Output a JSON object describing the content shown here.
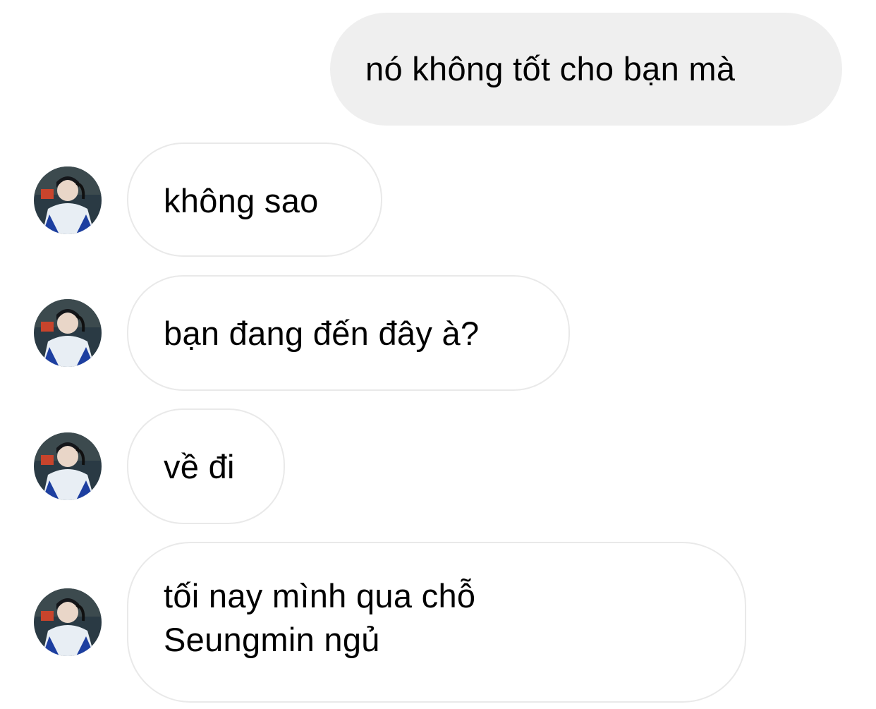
{
  "messages": [
    {
      "direction": "outgoing",
      "text": "nó không tốt cho bạn mà"
    },
    {
      "direction": "incoming",
      "text": "không sao"
    },
    {
      "direction": "incoming",
      "text": "bạn đang đến đây à?"
    },
    {
      "direction": "incoming",
      "text": "về đi"
    },
    {
      "direction": "incoming",
      "text": "tối nay mình qua chỗ\nSeungmin ngủ"
    }
  ],
  "avatar_icon": "contact-avatar-icon",
  "colors": {
    "outgoing_bubble": "#efefef",
    "incoming_border": "#e9e9e9",
    "text": "#000000"
  }
}
